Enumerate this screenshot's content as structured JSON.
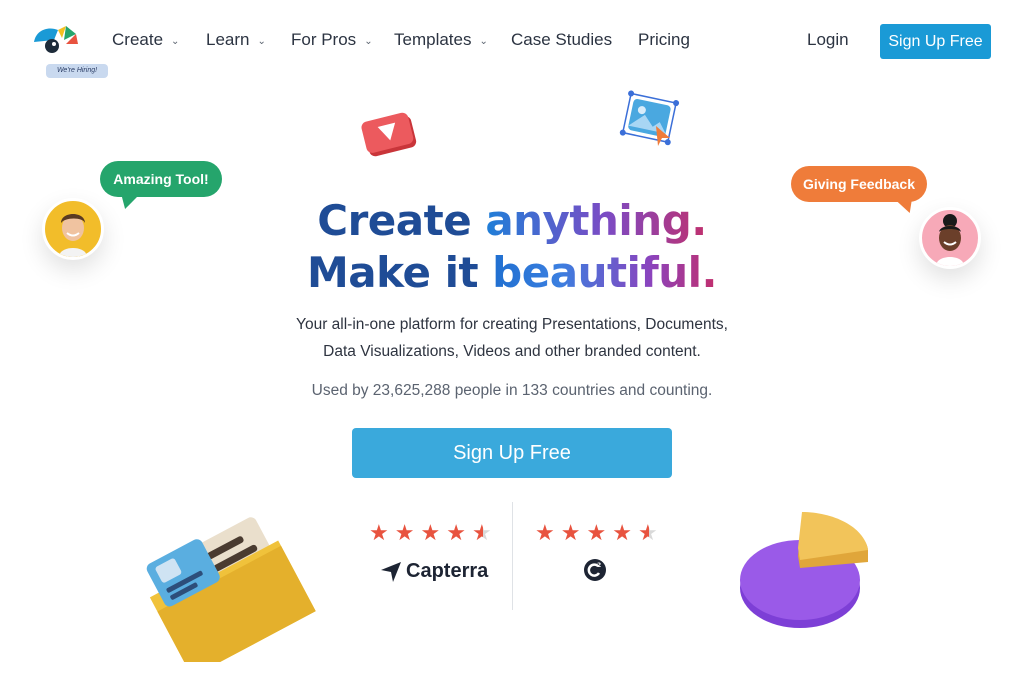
{
  "nav": {
    "hiring_badge": "We're Hiring!",
    "items": [
      {
        "label": "Create",
        "dropdown": true
      },
      {
        "label": "Learn",
        "dropdown": true
      },
      {
        "label": "For Pros",
        "dropdown": true
      },
      {
        "label": "Templates",
        "dropdown": true
      },
      {
        "label": "Case Studies",
        "dropdown": false
      },
      {
        "label": "Pricing",
        "dropdown": false
      }
    ],
    "login": "Login",
    "signup": "Sign Up Free"
  },
  "hero": {
    "line1_a": "Create ",
    "line1_b": "anything.",
    "line2_a": "Make it ",
    "line2_b": "beautiful.",
    "subtitle_line1": "Your all-in-one platform for creating Presentations, Documents,",
    "subtitle_line2": "Data Visualizations, Videos and other branded content.",
    "used_by": "Used by 23,625,288 people in 133 countries and counting.",
    "cta": "Sign Up Free"
  },
  "bubbles": {
    "left": "Amazing Tool!",
    "right": "Giving Feedback"
  },
  "ratings": [
    {
      "source": "Capterra",
      "stars": 4.5
    },
    {
      "source": "G2",
      "stars": 4.5
    }
  ],
  "colors": {
    "brand_blue": "#1a9ad6",
    "cta_blue": "#3aa9dc",
    "green": "#25a56c",
    "orange": "#ef7c3a",
    "star": "#e8533f"
  }
}
